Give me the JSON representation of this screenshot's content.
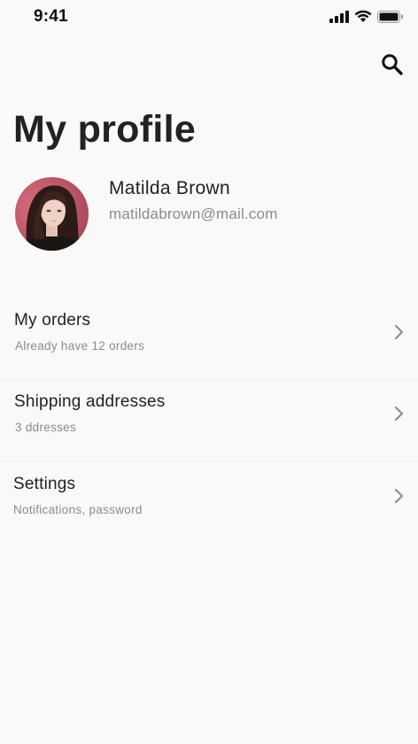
{
  "status_bar": {
    "time": "9:41",
    "icons": [
      "signal-icon",
      "wifi-icon",
      "battery-icon"
    ]
  },
  "header": {
    "title": "My profile",
    "search_icon": "search-icon"
  },
  "profile": {
    "name": "Matilda Brown",
    "email": "matildabrown@mail.com"
  },
  "menu": [
    {
      "title": "My orders",
      "subtitle": "Already have 12 orders"
    },
    {
      "title": "Shipping addresses",
      "subtitle": "3 ddresses"
    },
    {
      "title": "Settings",
      "subtitle": "Notifications, password"
    }
  ],
  "colors": {
    "background": "#f9f9f9",
    "text_primary": "#222222",
    "text_secondary": "#8b8b8b"
  }
}
